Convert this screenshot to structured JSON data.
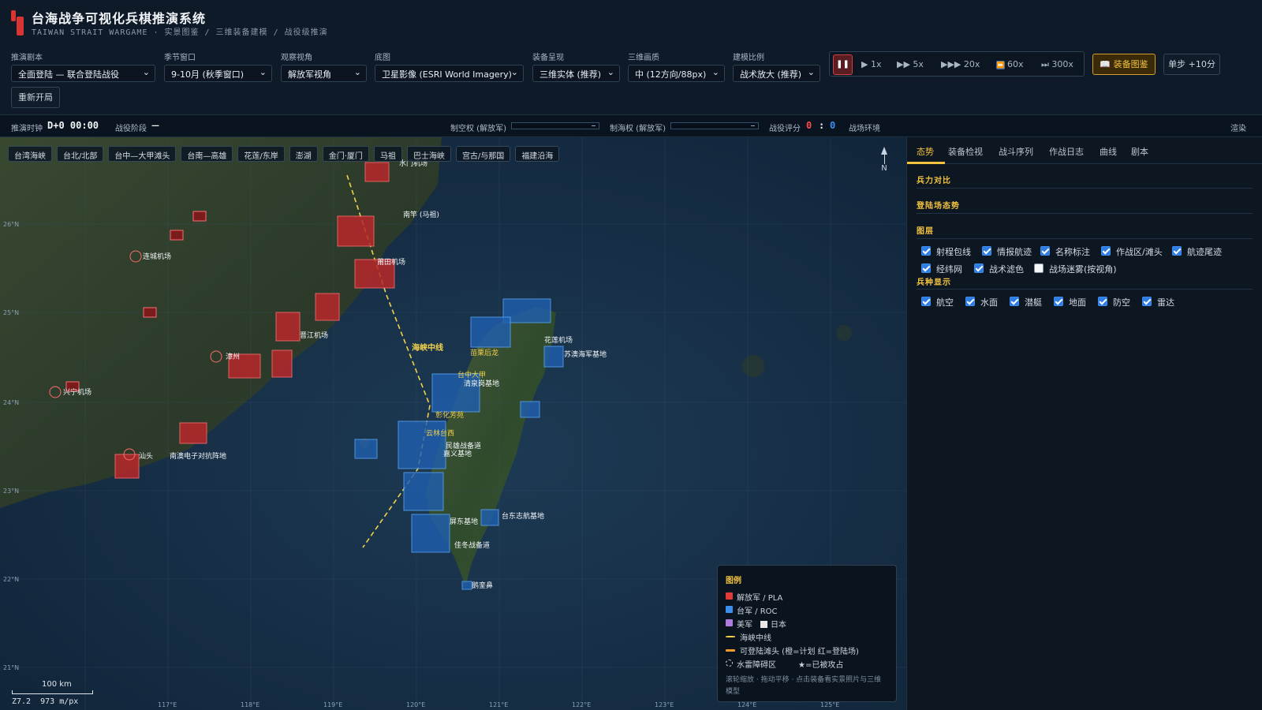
{
  "app": {
    "title": "台海战争可视化兵棋推演系统",
    "subtitle": "TAIWAN STRAIT WARGAME · 实景图鉴 / 三维装备建模 / 战役级推演"
  },
  "controls": [
    {
      "label": "推演剧本",
      "value": "全面登陆 — 联合登陆战役"
    },
    {
      "label": "季节窗口",
      "value": "9-10月 (秋季窗口)"
    },
    {
      "label": "观察视角",
      "value": "解放军视角"
    },
    {
      "label": "底图",
      "value": "卫星影像 (ESRI World Imagery)"
    },
    {
      "label": "装备呈现",
      "value": "三维实体 (推荐)"
    },
    {
      "label": "三维画质",
      "value": "中 (12方向/88px)"
    },
    {
      "label": "建模比例",
      "value": "战术放大 (推荐)"
    }
  ],
  "playback": {
    "pause_icon": "pause-icon",
    "speeds": [
      "▶ 1x",
      "▶▶ 5x",
      "▶▶▶ 20x",
      "60x",
      "⏭ 300x"
    ],
    "equipment_button": "📖 装备图鉴",
    "step_button": "单步 +10分",
    "restart_button": "重新开局"
  },
  "status": {
    "clock_label": "推演时钟",
    "clock_value": "D+0 00:00",
    "phase_label": "战役阶段",
    "phase_value": "—",
    "air_label": "制空权 (解放军)",
    "sea_label": "制海权 (解放军)",
    "score_label": "战役评分",
    "score_red": "0",
    "score_sep": ":",
    "score_blue": "0",
    "env_label": "战场环境",
    "render_label": "渲染"
  },
  "map_chips": [
    "台湾海峡",
    "台北/北部",
    "台中—大甲滩头",
    "台南—高雄",
    "花莲/东岸",
    "澎湖",
    "金门·厦门",
    "马祖",
    "巴士海峡",
    "宫古/与那国",
    "福建沿海"
  ],
  "map_labels": {
    "median_line": "海峡中线",
    "north": "N",
    "places_red": [
      "连城机场",
      "兴宁机场",
      "水门机场",
      "南竿 (马祖)",
      "莆田机场",
      "晋江机场",
      "漳州",
      "汕头",
      "南澳电子对抗阵地"
    ],
    "places_blue": [
      "苗栗后龙",
      "台中大甲",
      "清泉岗基地",
      "彰化芳苑",
      "云林台西",
      "民雄战备道",
      "嘉义基地",
      "台东志航基地",
      "屏东基地",
      "佳冬战备道",
      "苏澳海军基地",
      "花莲机场",
      "鹅銮鼻"
    ],
    "lat_ticks": [
      "26°N",
      "25°N",
      "24°N",
      "23°N",
      "22°N",
      "21°N"
    ],
    "lon_ticks": [
      "117°E",
      "118°E",
      "119°E",
      "120°E",
      "121°E",
      "122°E",
      "123°E",
      "124°E",
      "125°E"
    ]
  },
  "legend": {
    "title": "图例",
    "pla": "解放军 / PLA",
    "roc": "台军 / ROC",
    "us": "美军",
    "jp": "日本",
    "median": "海峡中线",
    "beach": "可登陆滩头 (橙=计划 红=登陆场)",
    "mine": "水雷障碍区",
    "captured": "★=已被攻占",
    "hint": "滚轮缩放 · 拖动平移 · 点击装备看实景照片与三维模型",
    "colors": {
      "pla": "#e03a3a",
      "roc": "#3b8ff0",
      "us": "#b07be0",
      "jp": "#e8e8e8",
      "median": "#f2d24a",
      "beach": "#f29a2e"
    }
  },
  "scale": {
    "bar": "100 km",
    "zoom": "Z7.2",
    "res": "973 m/px"
  },
  "panel": {
    "tabs": [
      "态势",
      "装备检视",
      "战斗序列",
      "作战日志",
      "曲线",
      "剧本"
    ],
    "force_title": "兵力对比",
    "landing_title": "登陆场态势",
    "layers_title": "图层",
    "layers": [
      {
        "label": "射程包线",
        "checked": true
      },
      {
        "label": "情报航迹",
        "checked": true
      },
      {
        "label": "名称标注",
        "checked": true
      },
      {
        "label": "作战区/滩头",
        "checked": true
      },
      {
        "label": "航迹尾迹",
        "checked": true
      },
      {
        "label": "经纬网",
        "checked": true
      },
      {
        "label": "战术滤色",
        "checked": true
      },
      {
        "label": "战场迷雾(按视角)",
        "checked": false
      }
    ],
    "branches_title": "兵种显示",
    "branches": [
      {
        "label": "航空",
        "checked": true
      },
      {
        "label": "水面",
        "checked": true
      },
      {
        "label": "潜艇",
        "checked": true
      },
      {
        "label": "地面",
        "checked": true
      },
      {
        "label": "防空",
        "checked": true
      },
      {
        "label": "雷达",
        "checked": true
      }
    ]
  }
}
